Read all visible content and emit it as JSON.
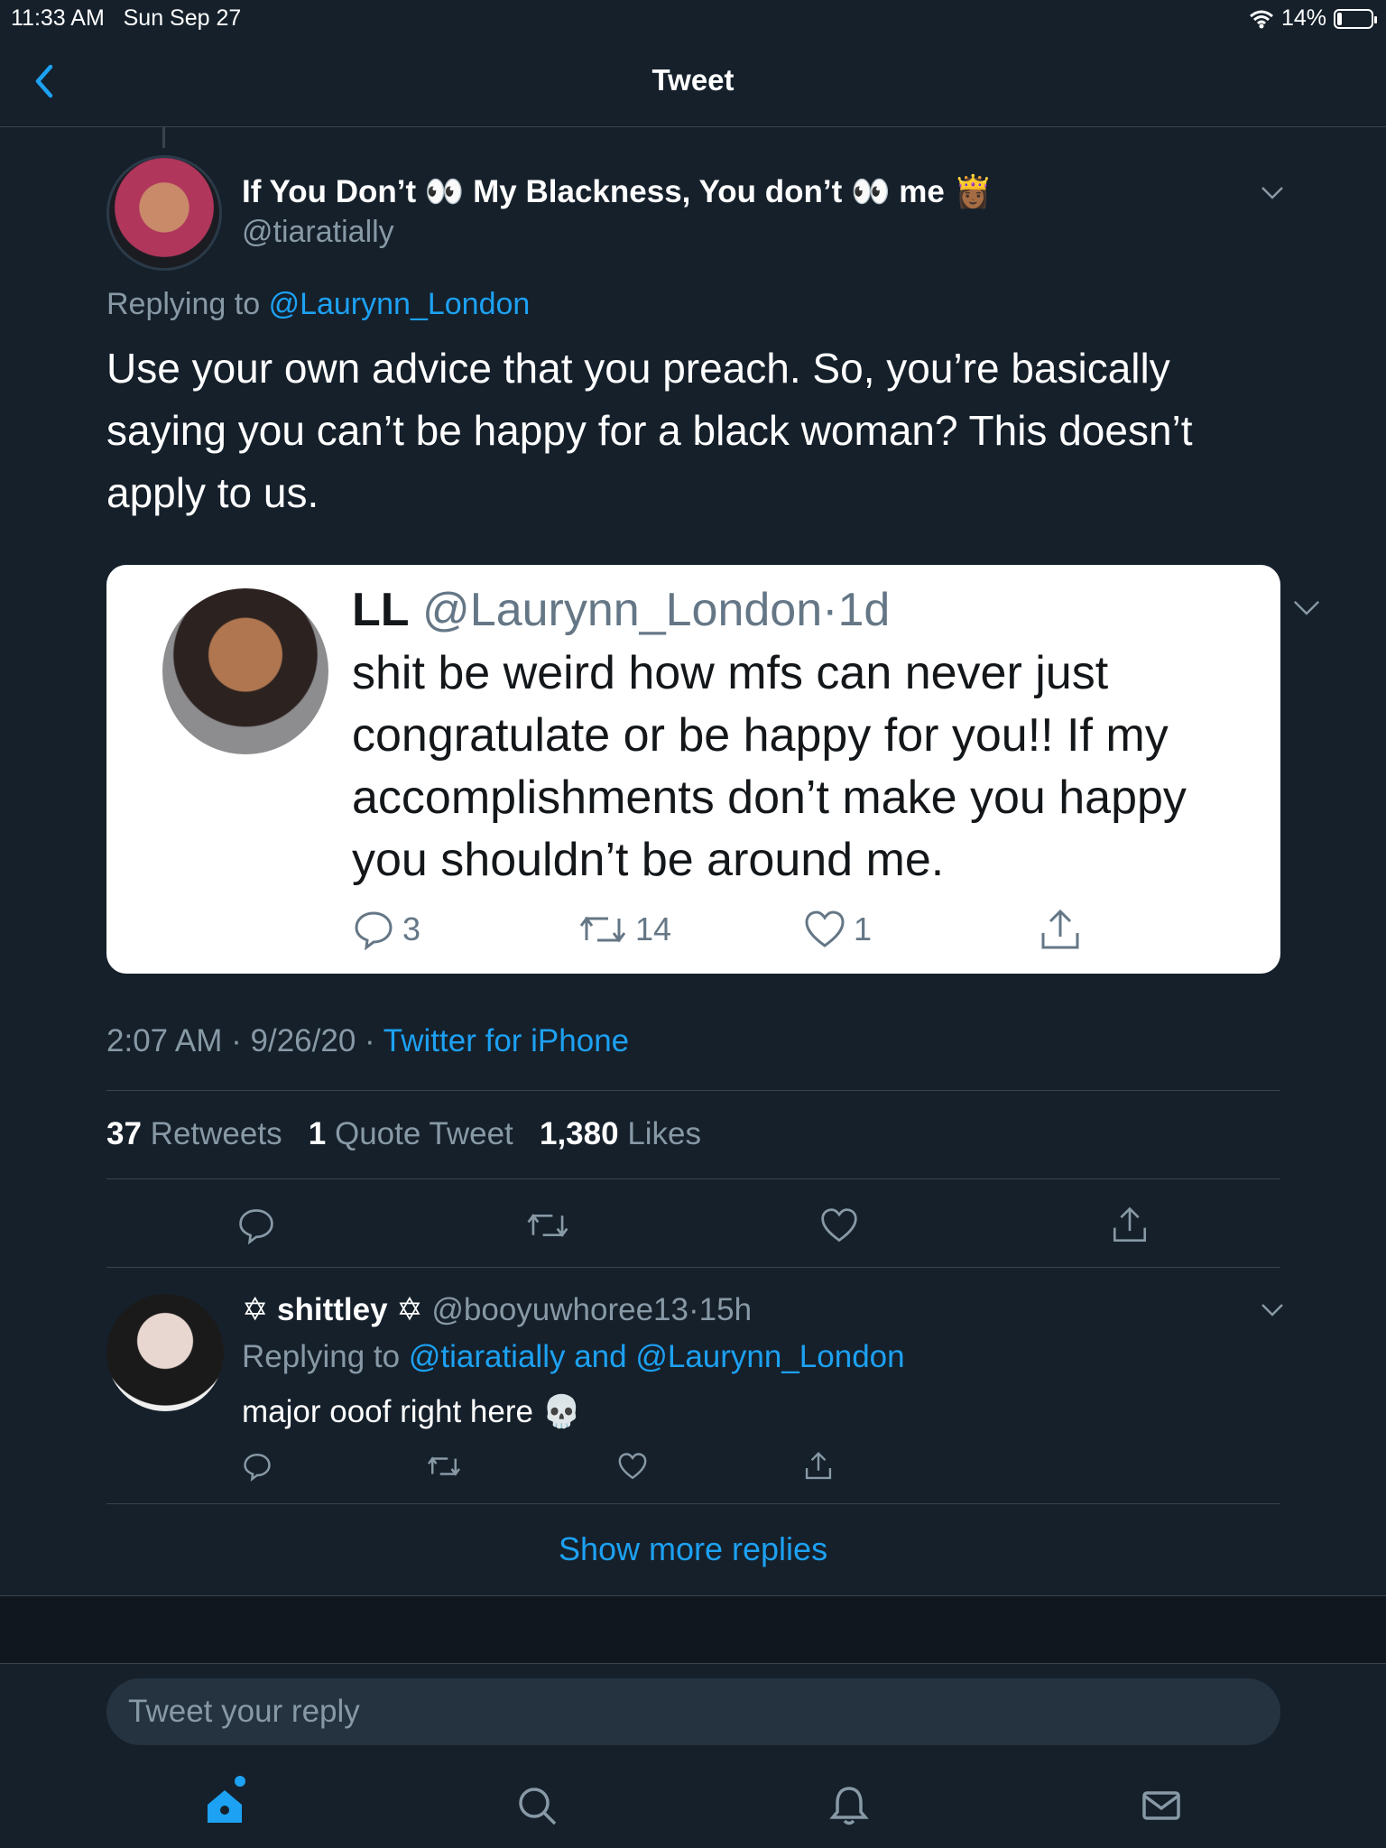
{
  "status_bar": {
    "time": "11:33 AM",
    "date": "Sun Sep 27",
    "battery": "14%",
    "battery_level": 0.14
  },
  "header": {
    "title": "Tweet"
  },
  "main_tweet": {
    "author_name": "If You Don’t 👀 My Blackness, You don’t 👀 me 👸🏾",
    "handle": "@tiaratially",
    "replying_prefix": "Replying to",
    "replying_to": "@Laurynn_London",
    "text": "Use your own advice that you preach. So, you’re basically saying you can’t be happy for a black woman? This doesn’t apply to us.",
    "time": "2:07 AM",
    "date": "9/26/20",
    "source": "Twitter for iPhone",
    "retweets": "37",
    "retweets_label": "Retweets",
    "quotes": "1",
    "quotes_label": "Quote Tweet",
    "likes": "1,380",
    "likes_label": "Likes"
  },
  "quoted_image": {
    "name": "LL",
    "handle": "@Laurynn_London",
    "age": "1d",
    "text": "shit be weird how mfs can never just congratulate or be happy for you!! If my accomplishments don’t make you happy you shouldn’t be around me.",
    "replies": "3",
    "retweets": "14",
    "likes": "1"
  },
  "reply": {
    "name": "✡ shittley ✡",
    "handle": "@booyuwhoree13",
    "age": "15h",
    "replying_prefix": "Replying to",
    "replying_to": "@tiaratially and @Laurynn_London",
    "text": "major ooof right here 💀"
  },
  "show_more": "Show more replies",
  "compose": {
    "placeholder": "Tweet your reply"
  },
  "colors": {
    "background": "#15202b",
    "accent": "#1da1f2",
    "muted": "#8899a6",
    "divider": "#38444d"
  },
  "tabs": [
    "home-icon",
    "search-icon",
    "notifications-icon",
    "messages-icon"
  ]
}
